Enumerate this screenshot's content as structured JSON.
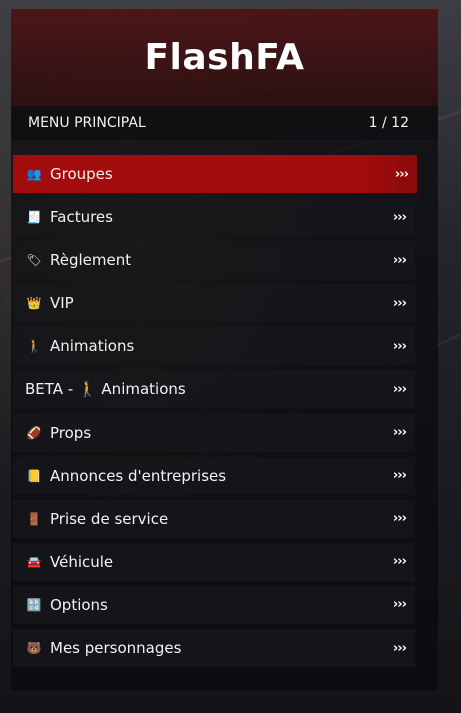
{
  "menu": {
    "title": "FlashFA",
    "subtitle": "MENU PRINCIPAL",
    "page_indicator": "1 / 12",
    "arrow_glyph": "›››",
    "accent_color": "#a30c0c",
    "items": [
      {
        "label": "Groupes",
        "icon": "people-emoji-icon",
        "glyph": "👥",
        "active": true
      },
      {
        "label": "Factures",
        "icon": "receipt-emoji-icon",
        "glyph": "🧾",
        "active": false
      },
      {
        "label": "Règlement",
        "icon": "tag-emoji-icon",
        "glyph": "🏷",
        "active": false
      },
      {
        "label": "VIP",
        "icon": "crown-emoji-icon",
        "glyph": "👑",
        "active": false
      },
      {
        "label": "Animations",
        "icon": "walking-person-emoji-icon",
        "glyph": "🚶",
        "active": false
      },
      {
        "label": "BETA - 🚶 Animations",
        "icon": null,
        "glyph": "",
        "active": false
      },
      {
        "label": "Props",
        "icon": "football-emoji-icon",
        "glyph": "🏈",
        "active": false
      },
      {
        "label": "Annonces d'entreprises",
        "icon": "ledger-emoji-icon",
        "glyph": "📒",
        "active": false
      },
      {
        "label": "Prise de service",
        "icon": "door-emoji-icon",
        "glyph": "🚪",
        "active": false
      },
      {
        "label": "Véhicule",
        "icon": "car-emoji-icon",
        "glyph": "🚘",
        "active": false
      },
      {
        "label": "Options",
        "icon": "abcd-emoji-icon",
        "glyph": "🔡",
        "active": false
      },
      {
        "label": "Mes personnages",
        "icon": "bear-emoji-icon",
        "glyph": "🐻",
        "active": false
      }
    ]
  }
}
